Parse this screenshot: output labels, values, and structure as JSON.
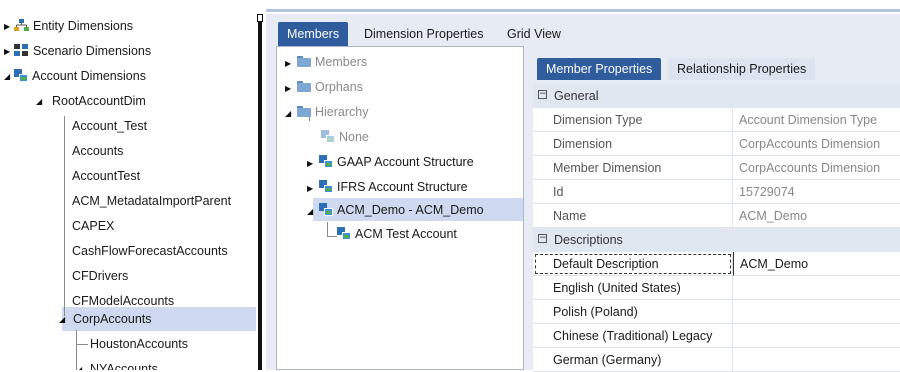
{
  "left_tree": {
    "items": [
      {
        "label": "Entity Dimensions"
      },
      {
        "label": "Scenario Dimensions"
      },
      {
        "label": "Account Dimensions"
      },
      {
        "label": "RootAccountDim"
      },
      {
        "label": "Account_Test"
      },
      {
        "label": "Accounts"
      },
      {
        "label": "AccountTest"
      },
      {
        "label": "ACM_MetadataImportParent"
      },
      {
        "label": "CAPEX"
      },
      {
        "label": "CashFlowForecastAccounts"
      },
      {
        "label": "CFDrivers"
      },
      {
        "label": "CFModelAccounts"
      },
      {
        "label": "CorpAccounts"
      },
      {
        "label": "HoustonAccounts"
      },
      {
        "label": "NYAccounts"
      }
    ]
  },
  "tabs": [
    "Members",
    "Dimension Properties",
    "Grid View"
  ],
  "members_tree": [
    {
      "label": "Members"
    },
    {
      "label": "Orphans"
    },
    {
      "label": "Hierarchy"
    },
    {
      "label": "None"
    },
    {
      "label": "GAAP Account Structure"
    },
    {
      "label": "IFRS Account Structure"
    },
    {
      "label": "ACM_Demo - ACM_Demo"
    },
    {
      "label": "ACM Test Account"
    }
  ],
  "property_tabs": [
    "Member Properties",
    "Relationship Properties"
  ],
  "property_grid": {
    "general": {
      "category": "General",
      "rows": [
        {
          "name": "Dimension Type",
          "value": "Account Dimension Type"
        },
        {
          "name": "Dimension",
          "value": "CorpAccounts Dimension"
        },
        {
          "name": "Member Dimension",
          "value": "CorpAccounts Dimension"
        },
        {
          "name": "Id",
          "value": "15729074"
        },
        {
          "name": "Name",
          "value": "ACM_Demo"
        }
      ]
    },
    "descriptions": {
      "category": "Descriptions",
      "rows": [
        {
          "name": "Default Description",
          "value": "ACM_Demo"
        },
        {
          "name": "English (United States)",
          "value": ""
        },
        {
          "name": "Polish (Poland)",
          "value": ""
        },
        {
          "name": "Chinese (Traditional) Legacy",
          "value": ""
        },
        {
          "name": "German (Germany)",
          "value": ""
        }
      ]
    }
  },
  "colors": {
    "tab_active": "#2e5c9c",
    "selection": "#cfd9ef",
    "panel_bg": "#e7ecf4"
  }
}
